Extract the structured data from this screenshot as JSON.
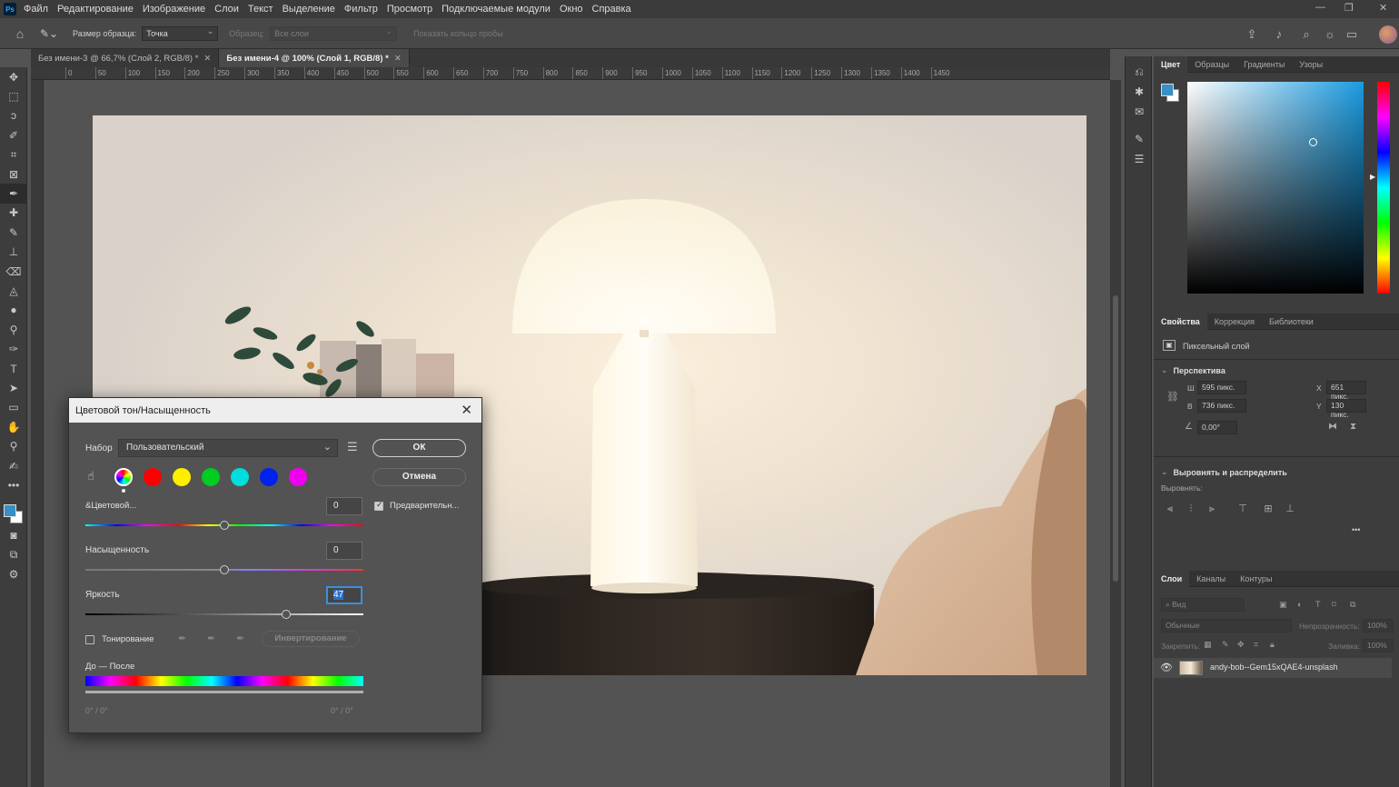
{
  "menubar": {
    "logo": "Ps",
    "items": [
      "Файл",
      "Редактирование",
      "Изображение",
      "Слои",
      "Текст",
      "Выделение",
      "Фильтр",
      "Просмотр",
      "Подключаемые модули",
      "Окно",
      "Справка"
    ]
  },
  "options": {
    "sample_size_label": "Размер образца:",
    "sample_size_value": "Точка",
    "sample_label": "Образец:",
    "sample_value": "Все слои",
    "show_ring_label": "Показать кольцо пробы"
  },
  "tabs": [
    {
      "label": "Без имени-3 @ 66,7% (Слой 2, RGB/8) *",
      "active": false
    },
    {
      "label": "Без имени-4 @ 100% (Слой 1, RGB/8) *",
      "active": true
    }
  ],
  "ruler_ticks": [
    "0",
    "50",
    "100",
    "150",
    "200",
    "250",
    "300",
    "350",
    "400",
    "450",
    "500",
    "550",
    "600",
    "650",
    "700",
    "750",
    "800",
    "850",
    "900",
    "950",
    "1000",
    "1050",
    "1100",
    "1150",
    "1200",
    "1250",
    "1300",
    "1350",
    "1400",
    "1450"
  ],
  "color_panel": {
    "tabs": [
      "Цвет",
      "Образцы",
      "Градиенты",
      "Узоры"
    ],
    "fg_color": "#3a8fc4"
  },
  "properties": {
    "tabs": [
      "Свойства",
      "Коррекция",
      "Библиотеки"
    ],
    "layer_kind": "Пиксельный слой",
    "perspective_title": "Перспектива",
    "w_label": "Ш",
    "w_value": "595 пикс.",
    "h_label": "В",
    "h_value": "736 пикс.",
    "x_label": "X",
    "x_value": "651 пикс.",
    "y_label": "Y",
    "y_value": "130 пикс.",
    "angle_value": "0,00°",
    "align_title": "Выровнять и распределить",
    "align_label": "Выровнять:",
    "more": "•••"
  },
  "layers": {
    "tabs": [
      "Слои",
      "Каналы",
      "Контуры"
    ],
    "search_placeholder": "Вид",
    "blend_mode": "Обычные",
    "opacity_label": "Непрозрачность:",
    "opacity_value": "100%",
    "lock_label": "Закрепить:",
    "fill_label": "Заливка:",
    "fill_value": "100%",
    "layer_name": "andy-bob--Gem15xQAE4-unsplash"
  },
  "dialog": {
    "title": "Цветовой тон/Насыщенность",
    "preset_label": "Набор",
    "preset_value": "Пользовательский",
    "ok": "ОК",
    "cancel": "Отмена",
    "swatch_colors": [
      "#ff0000",
      "#ffee00",
      "#00cc22",
      "#00dddd",
      "#0022ee",
      "#ee00ee"
    ],
    "hue_label": "&Цветовой...",
    "hue_value": "0",
    "preview_label": "Предварительн...",
    "saturation_label": "Насыщенность",
    "saturation_value": "0",
    "lightness_label": "Яркость",
    "lightness_value": "47",
    "colorize_label": "Тонирование",
    "invert_label": "Инвертирование",
    "before_after_label": "До — После",
    "range_left": "0° / 0°",
    "range_right": "0° / 0°"
  }
}
